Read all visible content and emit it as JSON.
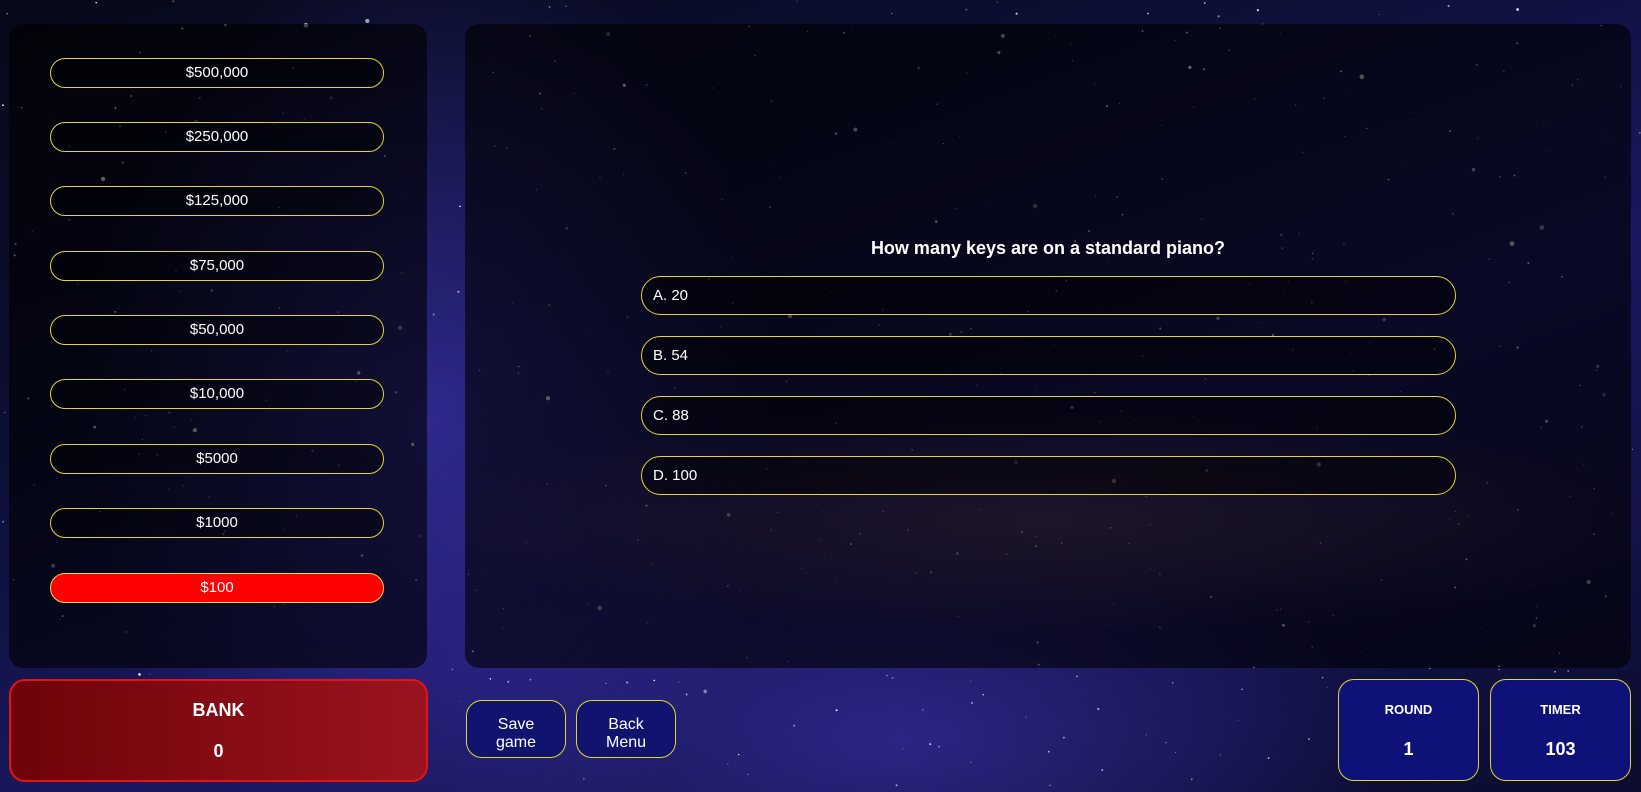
{
  "ladder": {
    "items": [
      {
        "label": "$500,000"
      },
      {
        "label": "$250,000"
      },
      {
        "label": "$125,000"
      },
      {
        "label": "$75,000"
      },
      {
        "label": "$50,000"
      },
      {
        "label": "$10,000"
      },
      {
        "label": "$5000"
      },
      {
        "label": "$1000"
      },
      {
        "label": "$100"
      }
    ],
    "current_label": "$100"
  },
  "question": {
    "text": "How many keys are on a standard piano?",
    "answers": [
      {
        "label": "A. 20"
      },
      {
        "label": "B. 54"
      },
      {
        "label": "C. 88"
      },
      {
        "label": "D. 100"
      }
    ]
  },
  "bank": {
    "label": "BANK",
    "value": "0"
  },
  "buttons": {
    "save_line1": "Save",
    "save_line2": "game",
    "back_line1": "Back",
    "back_line2": "Menu"
  },
  "round": {
    "label": "ROUND",
    "value": "1"
  },
  "timer": {
    "label": "TIMER",
    "value": "103"
  },
  "colors": {
    "accent_border": "#e3d532",
    "current_prize": "#ff0000",
    "bank_bg": "#8a0d16",
    "button_bg": "#10146e"
  }
}
